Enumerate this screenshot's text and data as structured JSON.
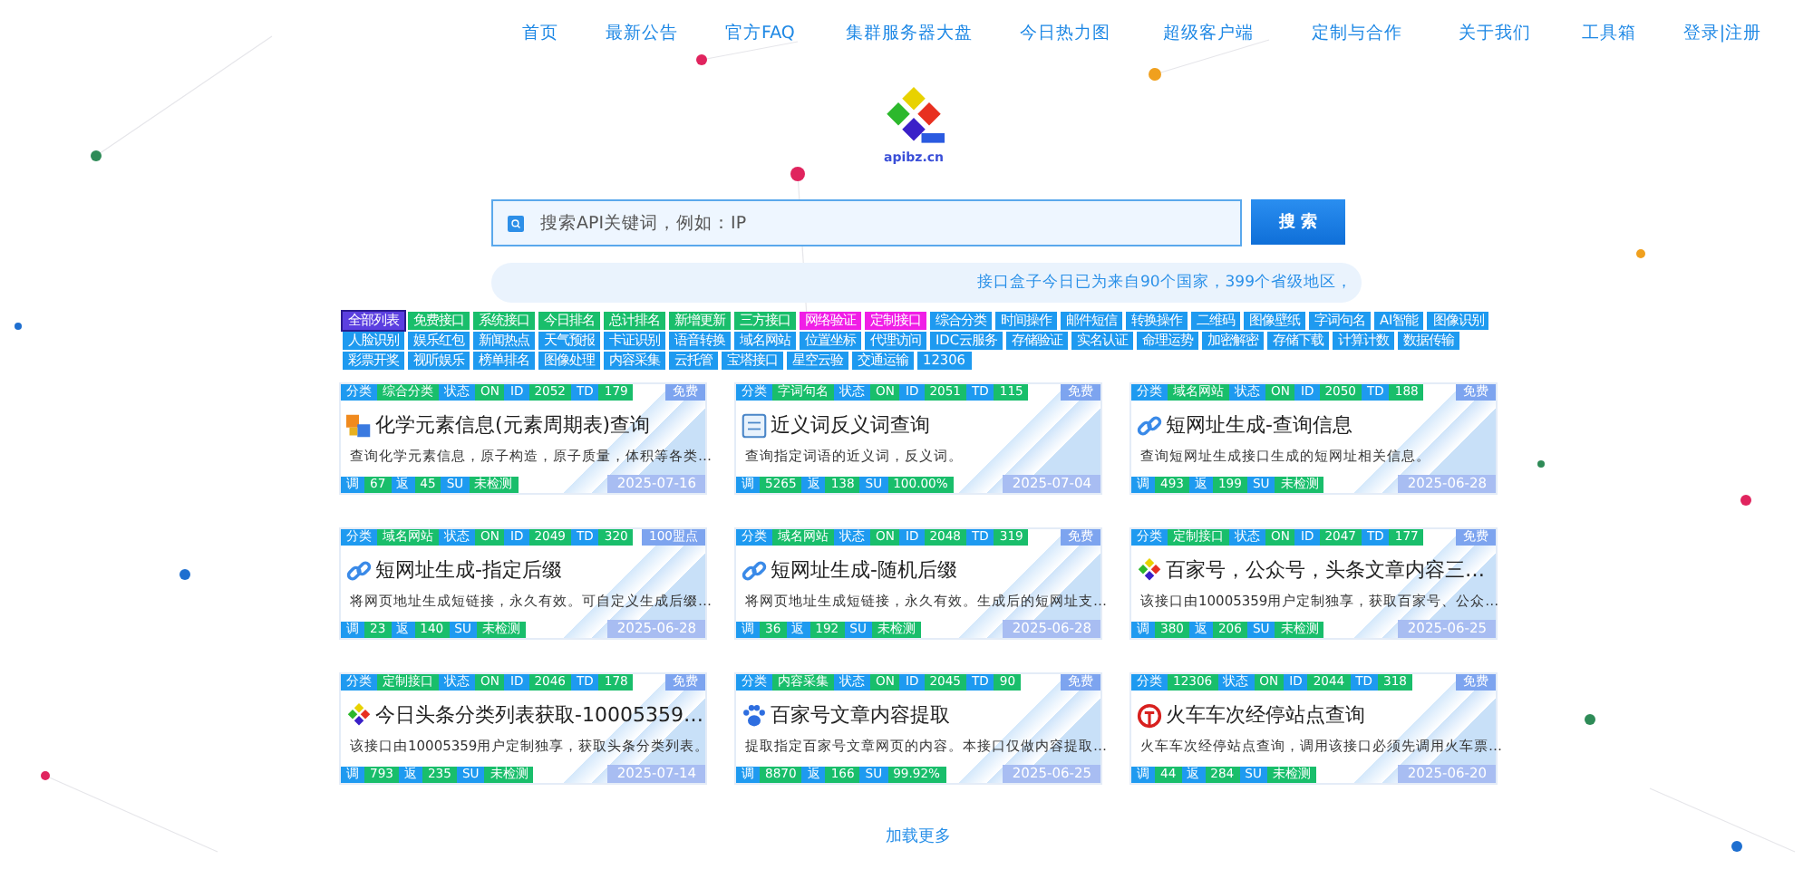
{
  "nav": [
    {
      "label": "首页",
      "selected": false
    },
    {
      "label": "最新公告",
      "selected": false
    },
    {
      "label": "官方FAQ",
      "selected": false
    },
    {
      "label": "集群服务器大盘",
      "selected": false
    },
    {
      "label": "今日热力图",
      "selected": false
    },
    {
      "label": "超级客户端",
      "selected": false
    },
    {
      "label": "定制与合作",
      "selected": false
    },
    {
      "label": "关于我们",
      "selected": false
    },
    {
      "label": "工具箱",
      "selected": false
    },
    {
      "label": "登录|注册",
      "selected": false
    }
  ],
  "logo": {
    "text": "apibz.cn"
  },
  "search": {
    "placeholder": "搜索API关键词，例如：IP",
    "button": "搜 索"
  },
  "notice": "接口盒子今日已为来自90个国家，399个省级地区，",
  "categories": [
    {
      "label": "全部列表",
      "selected": true,
      "color": "#5b3fe0"
    },
    {
      "label": "免费接口",
      "selected": false,
      "color": "#19be6b"
    },
    {
      "label": "系统接口",
      "selected": false,
      "color": "#19be6b"
    },
    {
      "label": "今日排名",
      "selected": false,
      "color": "#19be6b"
    },
    {
      "label": "总计排名",
      "selected": false,
      "color": "#19be6b"
    },
    {
      "label": "新增更新",
      "selected": false,
      "color": "#19be6b"
    },
    {
      "label": "三方接口",
      "selected": false,
      "color": "#19be6b"
    },
    {
      "label": "网络验证",
      "selected": false,
      "color": "#f01ee6"
    },
    {
      "label": "定制接口",
      "selected": false,
      "color": "#f01ee6"
    },
    {
      "label": "综合分类",
      "selected": false,
      "color": "#1e9af0"
    },
    {
      "label": "时间操作",
      "selected": false,
      "color": "#1e9af0"
    },
    {
      "label": "邮件短信",
      "selected": false,
      "color": "#1e9af0"
    },
    {
      "label": "转换操作",
      "selected": false,
      "color": "#1e9af0"
    },
    {
      "label": "二维码",
      "selected": false,
      "color": "#1e9af0"
    },
    {
      "label": "图像壁纸",
      "selected": false,
      "color": "#1e9af0"
    },
    {
      "label": "字词句名",
      "selected": false,
      "color": "#1e9af0"
    },
    {
      "label": "AI智能",
      "selected": false,
      "color": "#1e9af0"
    },
    {
      "label": "图像识别",
      "selected": false,
      "color": "#1e9af0"
    },
    {
      "label": "人脸识别",
      "selected": false,
      "color": "#1e9af0"
    },
    {
      "label": "娱乐红包",
      "selected": false,
      "color": "#1e9af0"
    },
    {
      "label": "新闻热点",
      "selected": false,
      "color": "#1e9af0"
    },
    {
      "label": "天气预报",
      "selected": false,
      "color": "#1e9af0"
    },
    {
      "label": "卡证识别",
      "selected": false,
      "color": "#1e9af0"
    },
    {
      "label": "语音转换",
      "selected": false,
      "color": "#1e9af0"
    },
    {
      "label": "域名网站",
      "selected": false,
      "color": "#1e9af0"
    },
    {
      "label": "位置坐标",
      "selected": false,
      "color": "#1e9af0"
    },
    {
      "label": "代理访问",
      "selected": false,
      "color": "#1e9af0"
    },
    {
      "label": "IDC云服务",
      "selected": false,
      "color": "#1e9af0"
    },
    {
      "label": "存储验证",
      "selected": false,
      "color": "#1e9af0"
    },
    {
      "label": "实名认证",
      "selected": false,
      "color": "#1e9af0"
    },
    {
      "label": "命理运势",
      "selected": false,
      "color": "#1e9af0"
    },
    {
      "label": "加密解密",
      "selected": false,
      "color": "#1e9af0"
    },
    {
      "label": "存储下载",
      "selected": false,
      "color": "#1e9af0"
    },
    {
      "label": "计算计数",
      "selected": false,
      "color": "#1e9af0"
    },
    {
      "label": "数据传输",
      "selected": false,
      "color": "#1e9af0"
    },
    {
      "label": "彩票开奖",
      "selected": false,
      "color": "#1e9af0"
    },
    {
      "label": "视听娱乐",
      "selected": false,
      "color": "#1e9af0"
    },
    {
      "label": "榜单排名",
      "selected": false,
      "color": "#1e9af0"
    },
    {
      "label": "图像处理",
      "selected": false,
      "color": "#1e9af0"
    },
    {
      "label": "内容采集",
      "selected": false,
      "color": "#1e9af0"
    },
    {
      "label": "云托管",
      "selected": false,
      "color": "#1e9af0"
    },
    {
      "label": "宝塔接口",
      "selected": false,
      "color": "#1e9af0"
    },
    {
      "label": "星空云验",
      "selected": false,
      "color": "#1e9af0"
    },
    {
      "label": "交通运输",
      "selected": false,
      "color": "#1e9af0"
    },
    {
      "label": "12306",
      "selected": false,
      "color": "#1e9af0"
    }
  ],
  "cards": [
    {
      "kind": "element",
      "header": [
        {
          "k": "分类",
          "v": "综合分类"
        },
        {
          "k": "状态",
          "v": "ON"
        },
        {
          "k": "ID",
          "v": "2052"
        },
        {
          "k": "TD",
          "v": "179"
        }
      ],
      "price": "免费",
      "title": "化学元素信息(元素周期表)查询",
      "desc": "查询化学元素信息，原子构造，原子质量，体积等各类…",
      "footer": [
        {
          "k": "调",
          "v": "67"
        },
        {
          "k": "返",
          "v": "45"
        },
        {
          "k": "SU",
          "v": "未检测"
        }
      ],
      "date": "2025-07-16"
    },
    {
      "kind": "book",
      "header": [
        {
          "k": "分类",
          "v": "字词句名"
        },
        {
          "k": "状态",
          "v": "ON"
        },
        {
          "k": "ID",
          "v": "2051"
        },
        {
          "k": "TD",
          "v": "115"
        }
      ],
      "price": "免费",
      "title": "近义词反义词查询",
      "desc": "查询指定词语的近义词，反义词。",
      "footer": [
        {
          "k": "调",
          "v": "5265"
        },
        {
          "k": "返",
          "v": "138"
        },
        {
          "k": "SU",
          "v": "100.00%"
        }
      ],
      "date": "2025-07-04"
    },
    {
      "kind": "link",
      "header": [
        {
          "k": "分类",
          "v": "域名网站"
        },
        {
          "k": "状态",
          "v": "ON"
        },
        {
          "k": "ID",
          "v": "2050"
        },
        {
          "k": "TD",
          "v": "188"
        }
      ],
      "price": "免费",
      "title": "短网址生成-查询信息",
      "desc": "查询短网址生成接口生成的短网址相关信息。",
      "footer": [
        {
          "k": "调",
          "v": "493"
        },
        {
          "k": "返",
          "v": "199"
        },
        {
          "k": "SU",
          "v": "未检测"
        }
      ],
      "date": "2025-06-28"
    },
    {
      "kind": "link",
      "header": [
        {
          "k": "分类",
          "v": "域名网站"
        },
        {
          "k": "状态",
          "v": "ON"
        },
        {
          "k": "ID",
          "v": "2049"
        },
        {
          "k": "TD",
          "v": "320"
        }
      ],
      "price": "100盟点",
      "title": "短网址生成-指定后缀",
      "desc": "将网页地址生成短链接，永久有效。可自定义生成后缀…",
      "footer": [
        {
          "k": "调",
          "v": "23"
        },
        {
          "k": "返",
          "v": "140"
        },
        {
          "k": "SU",
          "v": "未检测"
        }
      ],
      "date": "2025-06-28"
    },
    {
      "kind": "link",
      "header": [
        {
          "k": "分类",
          "v": "域名网站"
        },
        {
          "k": "状态",
          "v": "ON"
        },
        {
          "k": "ID",
          "v": "2048"
        },
        {
          "k": "TD",
          "v": "319"
        }
      ],
      "price": "免费",
      "title": "短网址生成-随机后缀",
      "desc": "将网页地址生成短链接，永久有效。生成后的短网址支…",
      "footer": [
        {
          "k": "调",
          "v": "36"
        },
        {
          "k": "返",
          "v": "192"
        },
        {
          "k": "SU",
          "v": "未检测"
        }
      ],
      "date": "2025-06-28"
    },
    {
      "kind": "mosaic",
      "header": [
        {
          "k": "分类",
          "v": "定制接口"
        },
        {
          "k": "状态",
          "v": "ON"
        },
        {
          "k": "ID",
          "v": "2047"
        },
        {
          "k": "TD",
          "v": "177"
        }
      ],
      "price": "免费",
      "title": "百家号，公众号，头条文章内容三…",
      "desc": "该接口由10005359用户定制独享，获取百家号、公众…",
      "footer": [
        {
          "k": "调",
          "v": "380"
        },
        {
          "k": "返",
          "v": "206"
        },
        {
          "k": "SU",
          "v": "未检测"
        }
      ],
      "date": "2025-06-25"
    },
    {
      "kind": "mosaic",
      "header": [
        {
          "k": "分类",
          "v": "定制接口"
        },
        {
          "k": "状态",
          "v": "ON"
        },
        {
          "k": "ID",
          "v": "2046"
        },
        {
          "k": "TD",
          "v": "178"
        }
      ],
      "price": "免费",
      "title": "今日头条分类列表获取-10005359…",
      "desc": "该接口由10005359用户定制独享，获取头条分类列表。",
      "footer": [
        {
          "k": "调",
          "v": "793"
        },
        {
          "k": "返",
          "v": "235"
        },
        {
          "k": "SU",
          "v": "未检测"
        }
      ],
      "date": "2025-07-14"
    },
    {
      "kind": "paw",
      "header": [
        {
          "k": "分类",
          "v": "内容采集"
        },
        {
          "k": "状态",
          "v": "ON"
        },
        {
          "k": "ID",
          "v": "2045"
        },
        {
          "k": "TD",
          "v": "90"
        }
      ],
      "price": "免费",
      "title": "百家号文章内容提取",
      "desc": "提取指定百家号文章网页的内容。本接口仅做内容提取…",
      "footer": [
        {
          "k": "调",
          "v": "8870"
        },
        {
          "k": "返",
          "v": "166"
        },
        {
          "k": "SU",
          "v": "99.92%"
        }
      ],
      "date": "2025-06-25"
    },
    {
      "kind": "rail",
      "header": [
        {
          "k": "分类",
          "v": "12306"
        },
        {
          "k": "状态",
          "v": "ON"
        },
        {
          "k": "ID",
          "v": "2044"
        },
        {
          "k": "TD",
          "v": "318"
        }
      ],
      "price": "免费",
      "title": "火车车次经停站点查询",
      "desc": "火车车次经停站点查询，调用该接口必须先调用火车票…",
      "footer": [
        {
          "k": "调",
          "v": "44"
        },
        {
          "k": "返",
          "v": "284"
        },
        {
          "k": "SU",
          "v": "未检测"
        }
      ],
      "date": "2025-06-20"
    }
  ],
  "load_more": "加载更多"
}
